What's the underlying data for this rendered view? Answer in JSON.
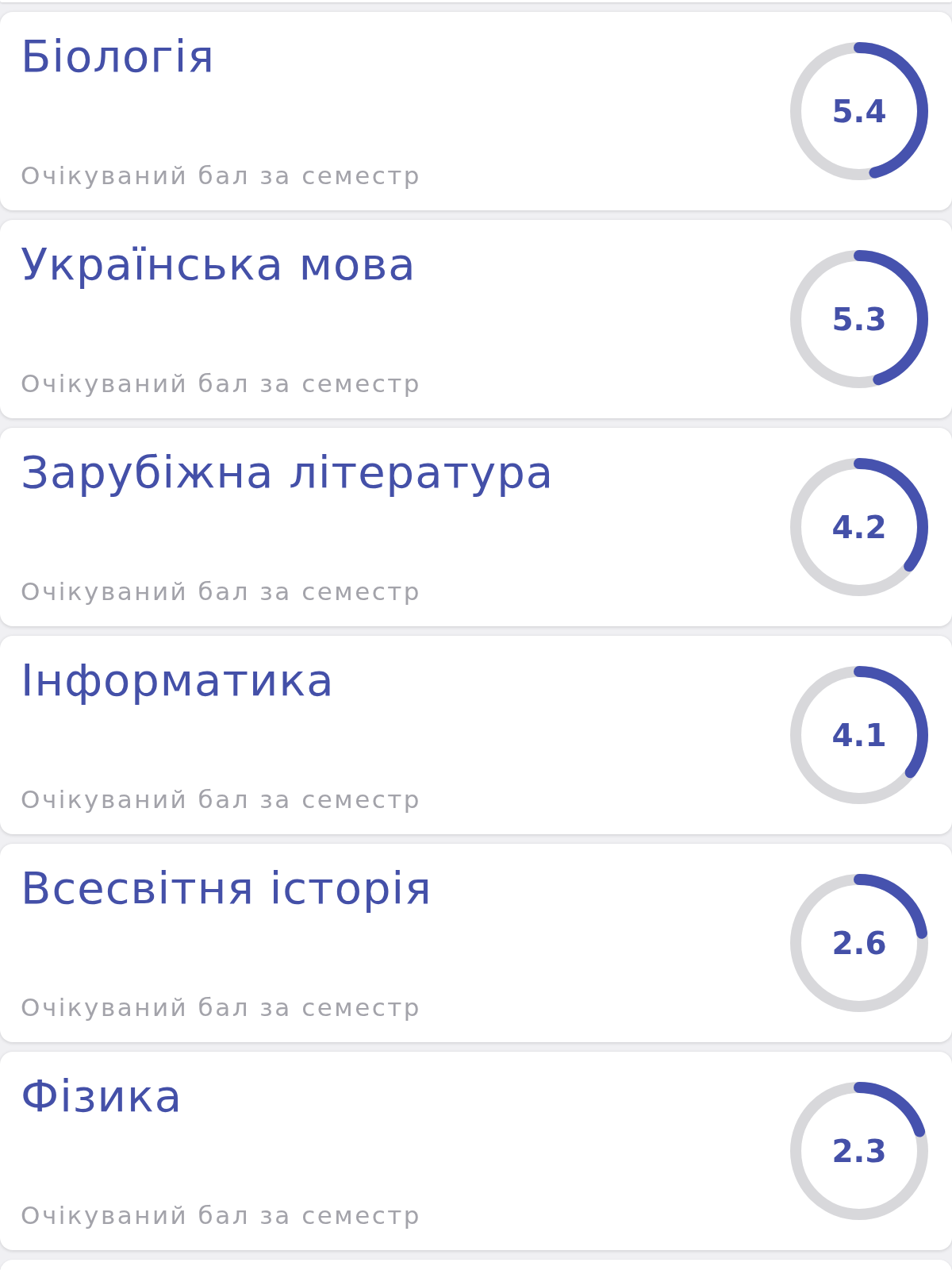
{
  "subjects": [
    {
      "title": "Біологія",
      "subtitle": "Очікуваний бал за семестр",
      "score": "5.4",
      "level": 0.46
    },
    {
      "title": "Українська мова",
      "subtitle": "Очікуваний бал за семестр",
      "score": "5.3",
      "level": 0.45
    },
    {
      "title": "Зарубіжна література",
      "subtitle": "Очікуваний бал за семестр",
      "score": "4.2",
      "level": 0.355
    },
    {
      "title": "Інформатика",
      "subtitle": "Очікуваний бал за семестр",
      "score": "4.1",
      "level": 0.35
    },
    {
      "title": "Всесвітня історія",
      "subtitle": "Очікуваний бал за семестр",
      "score": "2.6",
      "level": 0.225
    },
    {
      "title": "Фізика",
      "subtitle": "Очікуваний бал за семестр",
      "score": "2.3",
      "level": 0.2
    }
  ]
}
